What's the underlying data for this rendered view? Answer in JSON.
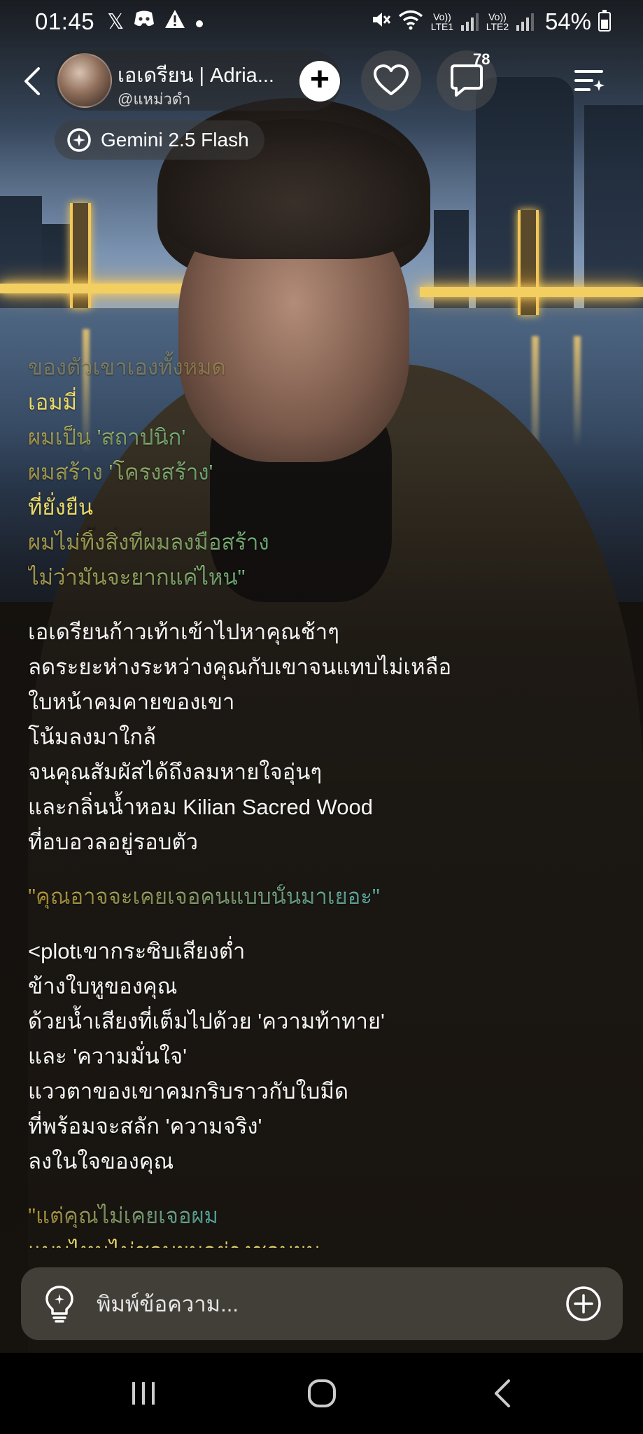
{
  "status_bar": {
    "time": "01:45",
    "notification_icons": [
      "x-icon",
      "discord-icon",
      "warning-icon",
      "dot-icon"
    ],
    "sim1_label": "Vo)) LTE1",
    "sim2_label": "Vo)) LTE2",
    "battery_percent": "54%"
  },
  "header": {
    "character_name": "เอเดรียน | Adria...",
    "character_handle": "@แหม่วดำ",
    "comment_count": "78",
    "model_name": "Gemini 2.5 Flash"
  },
  "chat": {
    "faded_line": "ของตัวเขาเองทั้งหมด",
    "blocks": [
      {
        "lines": [
          {
            "text": "เอมมี่",
            "style": "q-yellow"
          },
          {
            "text": "ผมเป็น 'สถาปนิก'",
            "style": "grad-a"
          },
          {
            "text": "ผมสร้าง 'โครงสร้าง'",
            "style": "grad-a"
          },
          {
            "text": "ที่ยั่งยืน",
            "style": "q-yellow"
          },
          {
            "text": "ผมไม่ทิ้งสิ่งที่ผมลงมือสร้าง",
            "style": "grad-a"
          },
          {
            "text": "ไม่ว่ามันจะยากแค่ไหน\"",
            "style": "grad-a"
          }
        ]
      },
      {
        "lines": [
          {
            "text": "เอเดรียนก้าวเท้าเข้าไปหาคุณช้าๆ",
            "style": "narr"
          },
          {
            "text": "ลดระยะห่างระหว่างคุณกับเขาจนแทบไม่เหลือ",
            "style": "narr"
          },
          {
            "text": "ใบหน้าคมคายของเขา",
            "style": "narr"
          },
          {
            "text": "โน้มลงมาใกล้",
            "style": "narr"
          },
          {
            "text": "จนคุณสัมผัสได้ถึงลมหายใจอุ่นๆ",
            "style": "narr"
          },
          {
            "text": "และกลิ่นน้ำหอม Kilian Sacred Wood",
            "style": "narr"
          },
          {
            "text": "ที่อบอวลอยู่รอบตัว",
            "style": "narr"
          }
        ]
      },
      {
        "lines": [
          {
            "text": "\"คุณอาจจะเคยเจอคนแบบนั้นมาเยอะ\"",
            "style": "grad-b"
          }
        ]
      },
      {
        "lines": [
          {
            "text": "<plotเขากระซิบเสียงต่ำ",
            "style": "narr"
          },
          {
            "text": "ข้างใบหูของคุณ",
            "style": "narr"
          },
          {
            "text": "ด้วยน้ำเสียงที่เต็มไปด้วย 'ความท้าทาย'",
            "style": "narr"
          },
          {
            "text": "และ 'ความมั่นใจ'",
            "style": "narr"
          },
          {
            "text": "แววตาของเขาคมกริบราวกับใบมีด",
            "style": "narr"
          },
          {
            "text": "ที่พร้อมจะสลัก 'ความจริง'",
            "style": "narr"
          },
          {
            "text": "ลงในใจของคุณ",
            "style": "narr"
          }
        ]
      },
      {
        "lines": [
          {
            "text": "\"แต่คุณไม่เคยเจอผม",
            "style": "grad-b"
          }
        ]
      }
    ],
    "cut_line": "แบบไหนไม่ชอบผมอย่างชอบผม"
  },
  "composer": {
    "placeholder": "พิมพ์ข้อความ..."
  },
  "colors": {
    "accent_yellow": "#e9d865",
    "accent_green": "#b4ec6e",
    "accent_cyan": "#7ce6cf",
    "composer_bg": "#46423c",
    "navbar_bg": "#000000"
  }
}
